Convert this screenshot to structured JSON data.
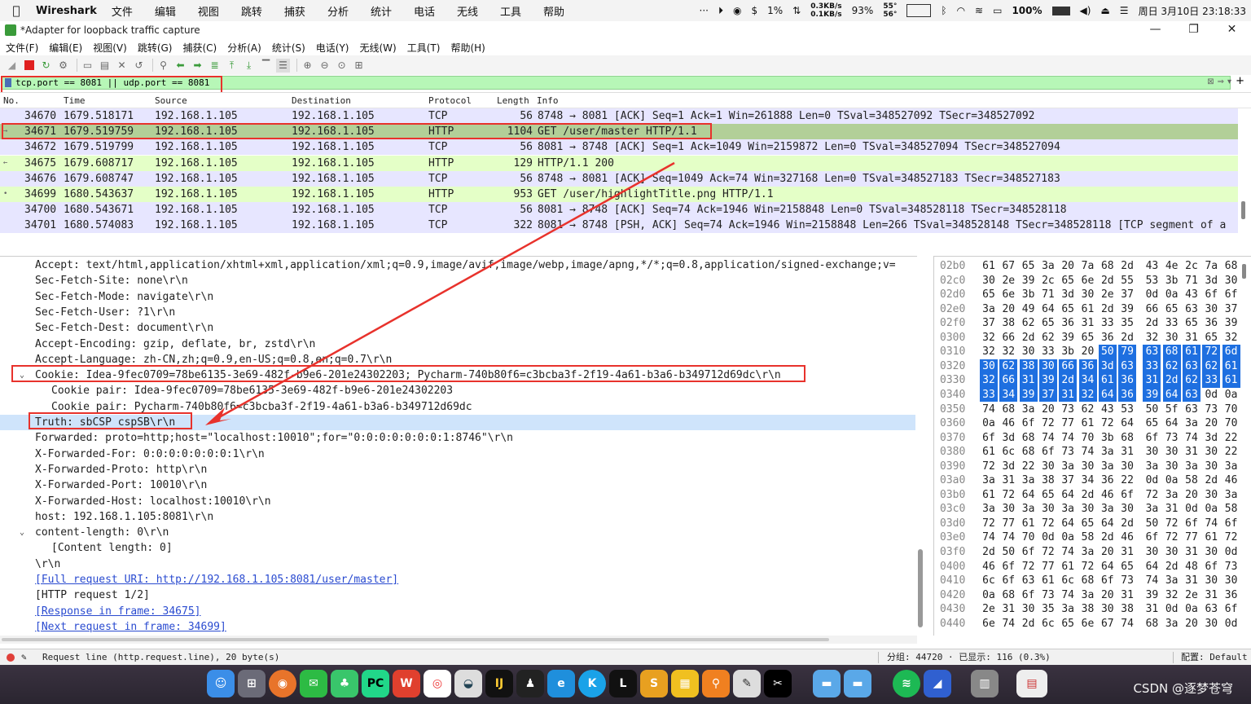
{
  "menubar": {
    "app_name": "Wireshark",
    "items": [
      "文件",
      "编辑",
      "视图",
      "跳转",
      "捕获",
      "分析",
      "统计",
      "电话",
      "无线",
      "工具",
      "帮助"
    ],
    "overflow": "···",
    "net_up": "0.3KB/s",
    "net_down": "0.1KB/s",
    "cpu": "1%",
    "mem": "93%",
    "temp_top": "55°",
    "temp_bottom": "56°",
    "battery": "100%",
    "datetime": "周日 3月10日 23:18:33"
  },
  "window": {
    "title": "*Adapter for loopback traffic capture",
    "minimize": "—",
    "maximize": "❐",
    "close": "✕"
  },
  "app_menu": [
    "文件(F)",
    "编辑(E)",
    "视图(V)",
    "跳转(G)",
    "捕获(C)",
    "分析(A)",
    "统计(S)",
    "电话(Y)",
    "无线(W)",
    "工具(T)",
    "帮助(H)"
  ],
  "filter": {
    "value": "tcp.port == 8081 || udp.port == 8081"
  },
  "packet_list": {
    "columns": [
      "No.",
      "Time",
      "Source",
      "Destination",
      "Protocol",
      "Length",
      "Info"
    ],
    "rows": [
      {
        "no": "34670",
        "time": "1679.518171",
        "src": "192.168.1.105",
        "dst": "192.168.1.105",
        "proto": "TCP",
        "len": "56",
        "info": "8748 → 8081 [ACK] Seq=1 Ack=1 Win=261888 Len=0 TSval=348527092 TSecr=348527092",
        "mark": ""
      },
      {
        "no": "34671",
        "time": "1679.519759",
        "src": "192.168.1.105",
        "dst": "192.168.1.105",
        "proto": "HTTP",
        "len": "1104",
        "info": "GET /user/master HTTP/1.1",
        "mark": "→"
      },
      {
        "no": "34672",
        "time": "1679.519799",
        "src": "192.168.1.105",
        "dst": "192.168.1.105",
        "proto": "TCP",
        "len": "56",
        "info": "8081 → 8748 [ACK] Seq=1 Ack=1049 Win=2159872 Len=0 TSval=348527094 TSecr=348527094",
        "mark": ""
      },
      {
        "no": "34675",
        "time": "1679.608717",
        "src": "192.168.1.105",
        "dst": "192.168.1.105",
        "proto": "HTTP",
        "len": "129",
        "info": "HTTP/1.1 200",
        "mark": "←"
      },
      {
        "no": "34676",
        "time": "1679.608747",
        "src": "192.168.1.105",
        "dst": "192.168.1.105",
        "proto": "TCP",
        "len": "56",
        "info": "8748 → 8081 [ACK] Seq=1049 Ack=74 Win=327168 Len=0 TSval=348527183 TSecr=348527183",
        "mark": ""
      },
      {
        "no": "34699",
        "time": "1680.543637",
        "src": "192.168.1.105",
        "dst": "192.168.1.105",
        "proto": "HTTP",
        "len": "953",
        "info": "GET /user/highlightTitle.png HTTP/1.1",
        "mark": "•"
      },
      {
        "no": "34700",
        "time": "1680.543671",
        "src": "192.168.1.105",
        "dst": "192.168.1.105",
        "proto": "TCP",
        "len": "56",
        "info": "8081 → 8748 [ACK] Seq=74 Ack=1946 Win=2158848 Len=0 TSval=348528118 TSecr=348528118",
        "mark": ""
      },
      {
        "no": "34701",
        "time": "1680.574083",
        "src": "192.168.1.105",
        "dst": "192.168.1.105",
        "proto": "TCP",
        "len": "322",
        "info": "8081 → 8748 [PSH, ACK] Seq=74 Ack=1946 Win=2158848 Len=266 TSval=348528148 TSecr=348528118 [TCP segment of a",
        "mark": ""
      }
    ]
  },
  "detail": {
    "lines": [
      {
        "indent": 2,
        "toggle": "",
        "text": "Accept: text/html,application/xhtml+xml,application/xml;q=0.9,image/avif,image/webp,image/apng,*/*;q=0.8,application/signed-exchange;v=",
        "style": ""
      },
      {
        "indent": 2,
        "toggle": "",
        "text": "Sec-Fetch-Site: none\\r\\n",
        "style": ""
      },
      {
        "indent": 2,
        "toggle": "",
        "text": "Sec-Fetch-Mode: navigate\\r\\n",
        "style": ""
      },
      {
        "indent": 2,
        "toggle": "",
        "text": "Sec-Fetch-User: ?1\\r\\n",
        "style": ""
      },
      {
        "indent": 2,
        "toggle": "",
        "text": "Sec-Fetch-Dest: document\\r\\n",
        "style": ""
      },
      {
        "indent": 2,
        "toggle": "",
        "text": "Accept-Encoding: gzip, deflate, br, zstd\\r\\n",
        "style": ""
      },
      {
        "indent": 2,
        "toggle": "",
        "text": "Accept-Language: zh-CN,zh;q=0.9,en-US;q=0.8,en;q=0.7\\r\\n",
        "style": ""
      },
      {
        "indent": 2,
        "toggle": "⌄",
        "text": "Cookie: Idea-9fec0709=78be6135-3e69-482f-b9e6-201e24302203; Pycharm-740b80f6=c3bcba3f-2f19-4a61-b3a6-b349712d69dc\\r\\n",
        "style": ""
      },
      {
        "indent": 3,
        "toggle": "",
        "text": "Cookie pair: Idea-9fec0709=78be6135-3e69-482f-b9e6-201e24302203",
        "style": ""
      },
      {
        "indent": 3,
        "toggle": "",
        "text": "Cookie pair: Pycharm-740b80f6=c3bcba3f-2f19-4a61-b3a6-b349712d69dc",
        "style": ""
      },
      {
        "indent": 2,
        "toggle": "",
        "text": "Truth: sbCSP cspSB\\r\\n",
        "style": "hl"
      },
      {
        "indent": 2,
        "toggle": "",
        "text": "Forwarded: proto=http;host=\"localhost:10010\";for=\"0:0:0:0:0:0:0:1:8746\"\\r\\n",
        "style": ""
      },
      {
        "indent": 2,
        "toggle": "",
        "text": "X-Forwarded-For: 0:0:0:0:0:0:0:1\\r\\n",
        "style": ""
      },
      {
        "indent": 2,
        "toggle": "",
        "text": "X-Forwarded-Proto: http\\r\\n",
        "style": ""
      },
      {
        "indent": 2,
        "toggle": "",
        "text": "X-Forwarded-Port: 10010\\r\\n",
        "style": ""
      },
      {
        "indent": 2,
        "toggle": "",
        "text": "X-Forwarded-Host: localhost:10010\\r\\n",
        "style": ""
      },
      {
        "indent": 2,
        "toggle": "",
        "text": "host: 192.168.1.105:8081\\r\\n",
        "style": ""
      },
      {
        "indent": 2,
        "toggle": "⌄",
        "text": "content-length: 0\\r\\n",
        "style": ""
      },
      {
        "indent": 3,
        "toggle": "",
        "text": "[Content length: 0]",
        "style": ""
      },
      {
        "indent": 2,
        "toggle": "",
        "text": "\\r\\n",
        "style": ""
      },
      {
        "indent": 2,
        "toggle": "",
        "text": "[Full request URI: http://192.168.1.105:8081/user/master]",
        "style": "link"
      },
      {
        "indent": 2,
        "toggle": "",
        "text": "[HTTP request 1/2]",
        "style": ""
      },
      {
        "indent": 2,
        "toggle": "",
        "text": "[Response in frame: 34675]",
        "style": "link"
      },
      {
        "indent": 2,
        "toggle": "",
        "text": "[Next request in frame: 34699]",
        "style": "link"
      }
    ]
  },
  "hex": {
    "rows": [
      {
        "off": "02b0",
        "bytes": [
          "61",
          "67",
          "65",
          "3a",
          "20",
          "7a",
          "68",
          "2d",
          "43",
          "4e",
          "2c",
          "7a",
          "68"
        ],
        "sel": []
      },
      {
        "off": "02c0",
        "bytes": [
          "30",
          "2e",
          "39",
          "2c",
          "65",
          "6e",
          "2d",
          "55",
          "53",
          "3b",
          "71",
          "3d",
          "30"
        ],
        "sel": []
      },
      {
        "off": "02d0",
        "bytes": [
          "65",
          "6e",
          "3b",
          "71",
          "3d",
          "30",
          "2e",
          "37",
          "0d",
          "0a",
          "43",
          "6f",
          "6f"
        ],
        "sel": []
      },
      {
        "off": "02e0",
        "bytes": [
          "3a",
          "20",
          "49",
          "64",
          "65",
          "61",
          "2d",
          "39",
          "66",
          "65",
          "63",
          "30",
          "37"
        ],
        "sel": []
      },
      {
        "off": "02f0",
        "bytes": [
          "37",
          "38",
          "62",
          "65",
          "36",
          "31",
          "33",
          "35",
          "2d",
          "33",
          "65",
          "36",
          "39"
        ],
        "sel": []
      },
      {
        "off": "0300",
        "bytes": [
          "32",
          "66",
          "2d",
          "62",
          "39",
          "65",
          "36",
          "2d",
          "32",
          "30",
          "31",
          "65",
          "32"
        ],
        "sel": []
      },
      {
        "off": "0310",
        "bytes": [
          "32",
          "32",
          "30",
          "33",
          "3b",
          "20",
          "50",
          "79",
          "63",
          "68",
          "61",
          "72",
          "6d"
        ],
        "sel": [
          6,
          7,
          8,
          9,
          10,
          11,
          12
        ]
      },
      {
        "off": "0320",
        "bytes": [
          "30",
          "62",
          "38",
          "30",
          "66",
          "36",
          "3d",
          "63",
          "33",
          "62",
          "63",
          "62",
          "61"
        ],
        "sel": [
          0,
          1,
          2,
          3,
          4,
          5,
          6,
          7,
          8,
          9,
          10,
          11,
          12
        ]
      },
      {
        "off": "0330",
        "bytes": [
          "32",
          "66",
          "31",
          "39",
          "2d",
          "34",
          "61",
          "36",
          "31",
          "2d",
          "62",
          "33",
          "61"
        ],
        "sel": [
          0,
          1,
          2,
          3,
          4,
          5,
          6,
          7,
          8,
          9,
          10,
          11,
          12
        ]
      },
      {
        "off": "0340",
        "bytes": [
          "33",
          "34",
          "39",
          "37",
          "31",
          "32",
          "64",
          "36",
          "39",
          "64",
          "63",
          "0d",
          "0a"
        ],
        "sel": [
          0,
          1,
          2,
          3,
          4,
          5,
          6,
          7,
          8,
          9,
          10
        ]
      },
      {
        "off": "0350",
        "bytes": [
          "74",
          "68",
          "3a",
          "20",
          "73",
          "62",
          "43",
          "53",
          "50",
          "5f",
          "63",
          "73",
          "70"
        ],
        "sel": []
      },
      {
        "off": "0360",
        "bytes": [
          "0a",
          "46",
          "6f",
          "72",
          "77",
          "61",
          "72",
          "64",
          "65",
          "64",
          "3a",
          "20",
          "70"
        ],
        "sel": []
      },
      {
        "off": "0370",
        "bytes": [
          "6f",
          "3d",
          "68",
          "74",
          "74",
          "70",
          "3b",
          "68",
          "6f",
          "73",
          "74",
          "3d",
          "22"
        ],
        "sel": []
      },
      {
        "off": "0380",
        "bytes": [
          "61",
          "6c",
          "68",
          "6f",
          "73",
          "74",
          "3a",
          "31",
          "30",
          "30",
          "31",
          "30",
          "22"
        ],
        "sel": []
      },
      {
        "off": "0390",
        "bytes": [
          "72",
          "3d",
          "22",
          "30",
          "3a",
          "30",
          "3a",
          "30",
          "3a",
          "30",
          "3a",
          "30",
          "3a"
        ],
        "sel": []
      },
      {
        "off": "03a0",
        "bytes": [
          "3a",
          "31",
          "3a",
          "38",
          "37",
          "34",
          "36",
          "22",
          "0d",
          "0a",
          "58",
          "2d",
          "46"
        ],
        "sel": []
      },
      {
        "off": "03b0",
        "bytes": [
          "61",
          "72",
          "64",
          "65",
          "64",
          "2d",
          "46",
          "6f",
          "72",
          "3a",
          "20",
          "30",
          "3a"
        ],
        "sel": []
      },
      {
        "off": "03c0",
        "bytes": [
          "3a",
          "30",
          "3a",
          "30",
          "3a",
          "30",
          "3a",
          "30",
          "3a",
          "31",
          "0d",
          "0a",
          "58"
        ],
        "sel": []
      },
      {
        "off": "03d0",
        "bytes": [
          "72",
          "77",
          "61",
          "72",
          "64",
          "65",
          "64",
          "2d",
          "50",
          "72",
          "6f",
          "74",
          "6f"
        ],
        "sel": []
      },
      {
        "off": "03e0",
        "bytes": [
          "74",
          "74",
          "70",
          "0d",
          "0a",
          "58",
          "2d",
          "46",
          "6f",
          "72",
          "77",
          "61",
          "72"
        ],
        "sel": []
      },
      {
        "off": "03f0",
        "bytes": [
          "2d",
          "50",
          "6f",
          "72",
          "74",
          "3a",
          "20",
          "31",
          "30",
          "30",
          "31",
          "30",
          "0d"
        ],
        "sel": []
      },
      {
        "off": "0400",
        "bytes": [
          "46",
          "6f",
          "72",
          "77",
          "61",
          "72",
          "64",
          "65",
          "64",
          "2d",
          "48",
          "6f",
          "73"
        ],
        "sel": []
      },
      {
        "off": "0410",
        "bytes": [
          "6c",
          "6f",
          "63",
          "61",
          "6c",
          "68",
          "6f",
          "73",
          "74",
          "3a",
          "31",
          "30",
          "30"
        ],
        "sel": []
      },
      {
        "off": "0420",
        "bytes": [
          "0a",
          "68",
          "6f",
          "73",
          "74",
          "3a",
          "20",
          "31",
          "39",
          "32",
          "2e",
          "31",
          "36"
        ],
        "sel": []
      },
      {
        "off": "0430",
        "bytes": [
          "2e",
          "31",
          "30",
          "35",
          "3a",
          "38",
          "30",
          "38",
          "31",
          "0d",
          "0a",
          "63",
          "6f"
        ],
        "sel": []
      },
      {
        "off": "0440",
        "bytes": [
          "6e",
          "74",
          "2d",
          "6c",
          "65",
          "6e",
          "67",
          "74",
          "68",
          "3a",
          "20",
          "30",
          "0d"
        ],
        "sel": []
      }
    ]
  },
  "status": {
    "message": "Request line (http.request.line), 20 byte(s)",
    "packets": "分组: 44720 · 已显示: 116 (0.3%)",
    "profile": "配置: Default"
  },
  "dock": {
    "watermark": "CSDN @逐梦苍穹"
  },
  "colors": {
    "tcp_row": "#e7e6ff",
    "http_row": "#e4ffc7",
    "selected_row": "#b2cf98",
    "filter_bg": "#b7f7b7",
    "hex_selection": "#1e6fe0",
    "annotation_red": "#e8322c"
  }
}
